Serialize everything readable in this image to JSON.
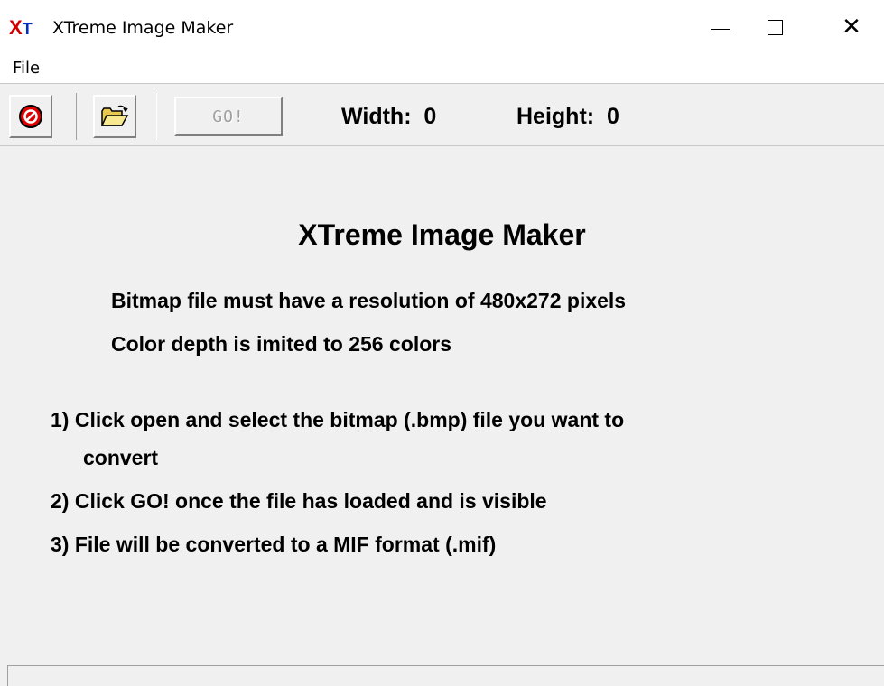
{
  "window": {
    "title": "XTreme Image Maker",
    "icon": "xt-app-icon",
    "controls": {
      "minimize": "minimize-icon",
      "maximize": "maximize-icon",
      "close": "close-icon"
    }
  },
  "menu": {
    "items": [
      {
        "label": "File"
      }
    ]
  },
  "toolbar": {
    "stop_icon": "stop-icon",
    "open_icon": "open-folder-icon",
    "go_label": "GO!",
    "go_enabled": false,
    "width_text": "Width:  0",
    "height_text": "Height:  0"
  },
  "main": {
    "title": "XTreme Image Maker",
    "requirements": [
      "Bitmap file must have a resolution of 480x272 pixels",
      "Color depth is imited to 256 colors"
    ],
    "steps": [
      "1) Click open and select the bitmap (.bmp) file you want to",
      "convert",
      "2) Click GO! once the file has loaded and is visible",
      "3) File will be converted to a MIF format (.mif)"
    ]
  },
  "colors": {
    "background": "#f0f0f0",
    "stop_red": "#e00000",
    "folder_yellow": "#f0d060",
    "icon_x_red": "#d00000",
    "icon_t_blue": "#0030c0"
  }
}
